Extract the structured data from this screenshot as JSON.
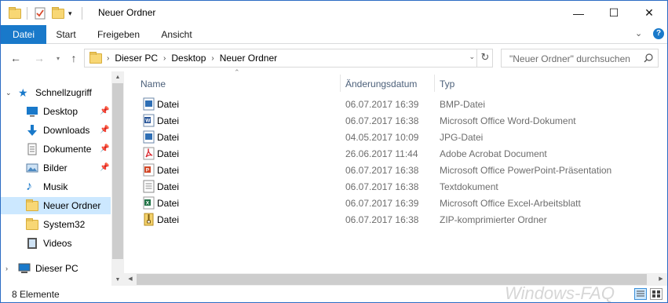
{
  "window": {
    "title": "Neuer Ordner",
    "controls": [
      "—",
      "☐",
      "✕"
    ]
  },
  "ribbon": {
    "tabs": [
      "Datei",
      "Start",
      "Freigeben",
      "Ansicht"
    ]
  },
  "address": {
    "path": [
      "Dieser PC",
      "Desktop",
      "Neuer Ordner"
    ],
    "search_placeholder": "\"Neuer Ordner\" durchsuchen"
  },
  "navpane": {
    "quick_access": "Schnellzugriff",
    "items": [
      {
        "label": "Desktop",
        "icon": "desktop-icon",
        "pinned": true
      },
      {
        "label": "Downloads",
        "icon": "downloads-icon",
        "pinned": true
      },
      {
        "label": "Dokumente",
        "icon": "documents-icon",
        "pinned": true
      },
      {
        "label": "Bilder",
        "icon": "pictures-icon",
        "pinned": true
      },
      {
        "label": "Musik",
        "icon": "music-icon",
        "pinned": false
      },
      {
        "label": "Neuer Ordner",
        "icon": "folder-icon",
        "pinned": false,
        "selected": true
      },
      {
        "label": "System32",
        "icon": "folder-icon",
        "pinned": false
      },
      {
        "label": "Videos",
        "icon": "videos-icon",
        "pinned": false
      }
    ],
    "this_pc": "Dieser PC"
  },
  "columns": {
    "name": "Name",
    "date": "Änderungsdatum",
    "type": "Typ"
  },
  "files": [
    {
      "name": "Datei",
      "date": "06.07.2017 16:39",
      "type": "BMP-Datei",
      "icon": "bmp-icon"
    },
    {
      "name": "Datei",
      "date": "06.07.2017 16:38",
      "type": "Microsoft Office Word-Dokument",
      "icon": "word-icon"
    },
    {
      "name": "Datei",
      "date": "04.05.2017 10:09",
      "type": "JPG-Datei",
      "icon": "jpg-icon"
    },
    {
      "name": "Datei",
      "date": "26.06.2017 11:44",
      "type": "Adobe Acrobat Document",
      "icon": "pdf-icon"
    },
    {
      "name": "Datei",
      "date": "06.07.2017 16:38",
      "type": "Microsoft Office PowerPoint-Präsentation",
      "icon": "powerpoint-icon"
    },
    {
      "name": "Datei",
      "date": "06.07.2017 16:38",
      "type": "Textdokument",
      "icon": "text-icon"
    },
    {
      "name": "Datei",
      "date": "06.07.2017 16:39",
      "type": "Microsoft Office Excel-Arbeitsblatt",
      "icon": "excel-icon"
    },
    {
      "name": "Datei",
      "date": "06.07.2017 16:38",
      "type": "ZIP-komprimierter Ordner",
      "icon": "zip-icon"
    }
  ],
  "status": {
    "count": "8 Elemente",
    "watermark": "Windows-FAQ"
  },
  "colors": {
    "accent": "#1979ca",
    "selection": "#cce8ff",
    "header_text": "#4c607a"
  }
}
